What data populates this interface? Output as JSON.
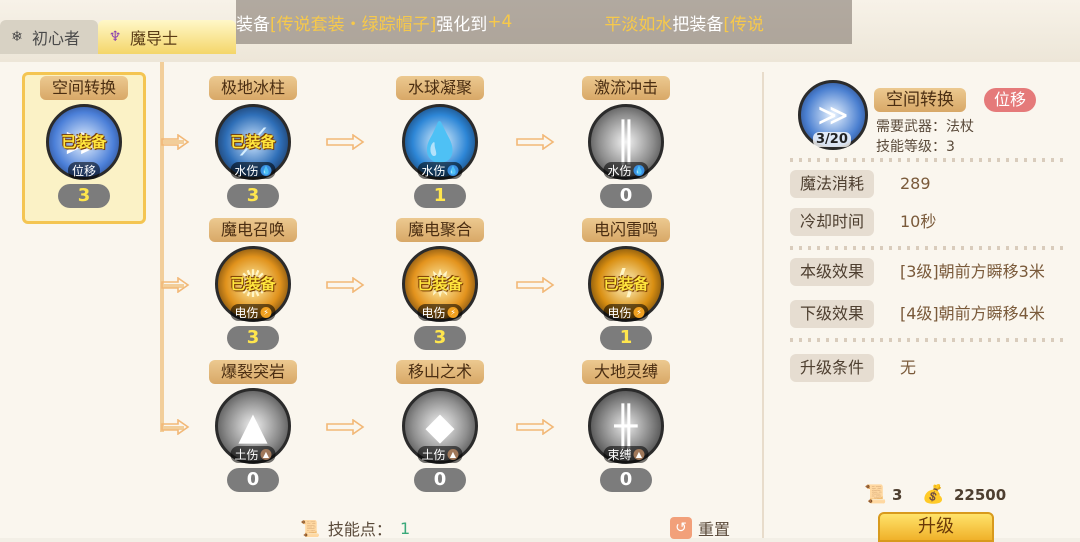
{
  "tabs": [
    {
      "label": "初心者",
      "icon": "snowflake-icon",
      "active": false
    },
    {
      "label": "魔导士",
      "icon": "staff-icon",
      "active": true
    }
  ],
  "marquee": {
    "part1_white": "装备",
    "part1_gold": "[传说套装・绿踪帽子]",
    "part1_white2": "强化到",
    "part1_gold2": "+4",
    "part2_gold": "平淡如水",
    "part2_white": "把装备",
    "part2_gold2": "[传说"
  },
  "equipped_label": "已装备",
  "selected_skill": {
    "name": "空间转换",
    "element": "位移",
    "level": "3",
    "equipped": true
  },
  "skill_rows": [
    [
      {
        "name": "极地冰柱",
        "element": "水伤",
        "element_type": "water",
        "level": "3",
        "equipped": true,
        "icon": "ice-pillar-icon"
      },
      {
        "name": "水球凝聚",
        "element": "水伤",
        "element_type": "water",
        "level": "1",
        "equipped": false,
        "icon": "water-drop-icon"
      },
      {
        "name": "激流冲击",
        "element": "水伤",
        "element_type": "water",
        "level": "0",
        "equipped": false,
        "icon": "torrent-icon"
      }
    ],
    [
      {
        "name": "魔电召唤",
        "element": "电伤",
        "element_type": "thunder",
        "level": "3",
        "equipped": true,
        "icon": "lightning-summon-icon"
      },
      {
        "name": "魔电聚合",
        "element": "电伤",
        "element_type": "thunder",
        "level": "3",
        "equipped": true,
        "icon": "lightning-gather-icon"
      },
      {
        "name": "电闪雷鸣",
        "element": "电伤",
        "element_type": "thunder",
        "level": "1",
        "equipped": true,
        "icon": "thunderstorm-icon"
      }
    ],
    [
      {
        "name": "爆裂突岩",
        "element": "土伤",
        "element_type": "earth",
        "level": "0",
        "equipped": false,
        "icon": "rock-burst-icon"
      },
      {
        "name": "移山之术",
        "element": "土伤",
        "element_type": "earth",
        "level": "0",
        "equipped": false,
        "icon": "mountain-icon"
      },
      {
        "name": "大地灵缚",
        "element": "束缚",
        "element_type": "earth",
        "level": "0",
        "equipped": false,
        "icon": "earth-bind-icon"
      }
    ]
  ],
  "detail": {
    "name": "空间转换",
    "tag": "位移",
    "progress": "3/20",
    "weapon_label": "需要武器：",
    "weapon_value": "法杖",
    "skill_level_label": "技能等级：",
    "skill_level_value": "3",
    "rows": [
      {
        "label": "魔法消耗",
        "value": "289"
      },
      {
        "label": "冷却时间",
        "value": "10秒"
      },
      {
        "label": "本级效果",
        "value": "[3级]朝前方瞬移3米"
      },
      {
        "label": "下级效果",
        "value": "[4级]朝前方瞬移4米"
      },
      {
        "label": "升级条件",
        "value": "无"
      }
    ]
  },
  "resources": {
    "book_count": "3",
    "gold": "22500"
  },
  "upgrade_label": "升级",
  "skill_points_label": "技能点：",
  "skill_points_value": "1",
  "reset_label": "重置",
  "colors": {
    "accent_gold": "#f4c552",
    "water": "#3a8fe0",
    "thunder": "#f0a020",
    "earth": "#a0785a"
  }
}
